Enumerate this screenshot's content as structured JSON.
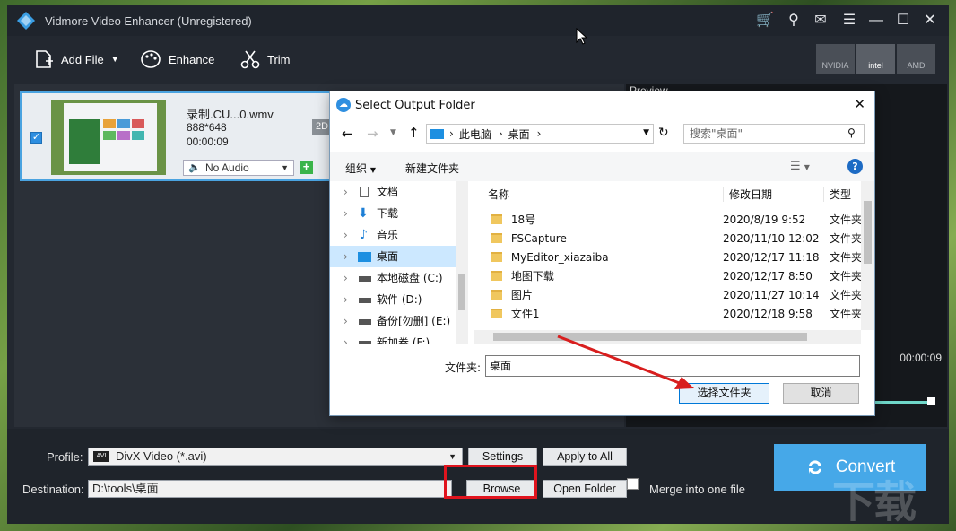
{
  "app": {
    "title": "Vidmore Video Enhancer (Unregistered)",
    "toolbar": {
      "add_file": "Add File",
      "enhance": "Enhance",
      "trim": "Trim"
    },
    "hw": {
      "nvidia": "NVIDIA",
      "intel": "intel",
      "amd": "AMD"
    }
  },
  "file_item": {
    "name": "录制.CU...0.wmv",
    "resolution": "888*648",
    "duration": "00:00:09",
    "badge": "2D",
    "audio": "No Audio"
  },
  "preview": {
    "label": "Preview",
    "time": "00:00:09"
  },
  "bottom": {
    "profile_label": "Profile:",
    "profile_value": "DivX Video (*.avi)",
    "profile_icon": "AVI",
    "settings": "Settings",
    "apply_all": "Apply to All",
    "destination_label": "Destination:",
    "destination_value": "D:\\tools\\桌面",
    "browse": "Browse",
    "open_folder": "Open Folder",
    "merge": "Merge into one file",
    "convert": "Convert"
  },
  "dialog": {
    "title": "Select Output Folder",
    "path": [
      "此电脑",
      "桌面"
    ],
    "search_placeholder": "搜索\"桌面\"",
    "organize": "组织",
    "new_folder": "新建文件夹",
    "nav": [
      {
        "label": "文档"
      },
      {
        "label": "下载"
      },
      {
        "label": "音乐"
      },
      {
        "label": "桌面"
      },
      {
        "label": "本地磁盘 (C:)"
      },
      {
        "label": "软件 (D:)"
      },
      {
        "label": "备份[勿删] (E:)"
      },
      {
        "label": "新加卷 (F:)"
      }
    ],
    "headers": {
      "name": "名称",
      "date": "修改日期",
      "type": "类型"
    },
    "files": [
      {
        "name": "18号",
        "date": "2020/8/19 9:52",
        "type": "文件夹"
      },
      {
        "name": "FSCapture",
        "date": "2020/11/10 12:02",
        "type": "文件夹"
      },
      {
        "name": "MyEditor_xiazaiba",
        "date": "2020/12/17 11:18",
        "type": "文件夹"
      },
      {
        "name": "地图下载",
        "date": "2020/12/17 8:50",
        "type": "文件夹"
      },
      {
        "name": "图片",
        "date": "2020/11/27 10:14",
        "type": "文件夹"
      },
      {
        "name": "文件1",
        "date": "2020/12/18 9:58",
        "type": "文件夹"
      }
    ],
    "folder_label": "文件夹:",
    "folder_value": "桌面",
    "select": "选择文件夹",
    "cancel": "取消"
  },
  "colors": {
    "accent": "#46a8e8",
    "highlight": "#e0141e",
    "arrow": "#d81e1e"
  }
}
